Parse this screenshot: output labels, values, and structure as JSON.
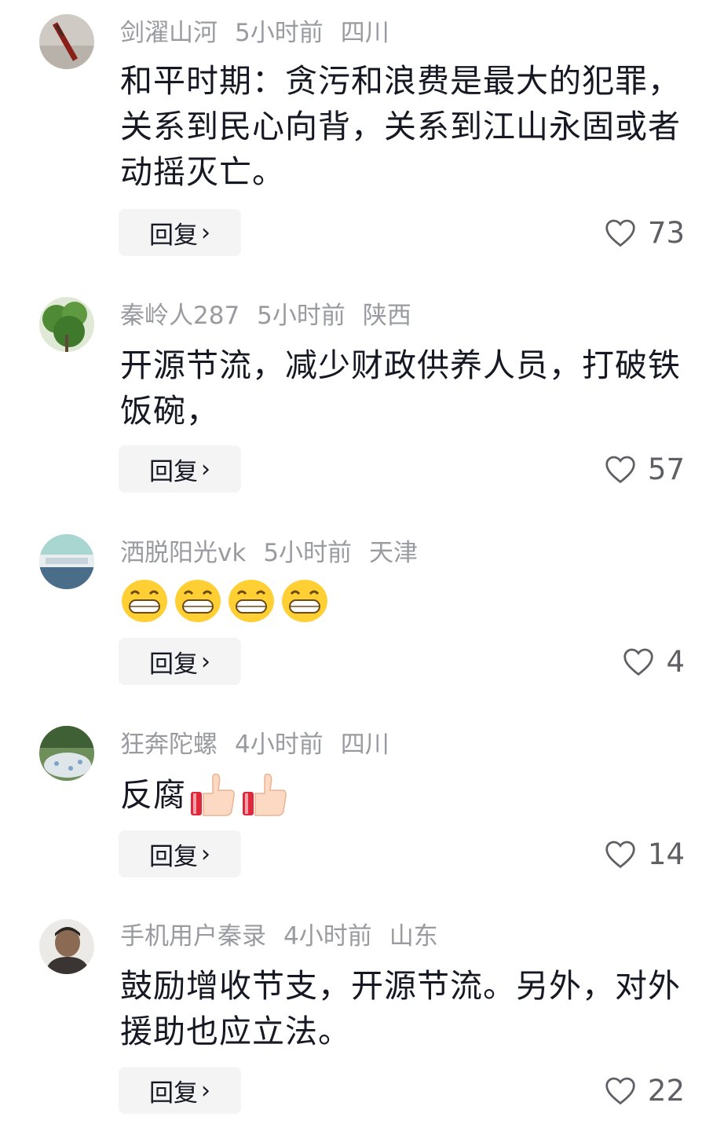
{
  "reply_label": "回复",
  "comments": [
    {
      "username": "剑濯山河",
      "time": "5小时前",
      "location": "四川",
      "text": "和平时期：贪污和浪费是最大的犯罪，关系到民心向背，关系到江山永固或者动摇灭亡。",
      "likes": "73"
    },
    {
      "username": "秦岭人287",
      "time": "5小时前",
      "location": "陕西",
      "text": "开源节流，减少财政供养人员，打破铁饭碗，",
      "likes": "57"
    },
    {
      "username": "洒脱阳光vk",
      "time": "5小时前",
      "location": "天津",
      "emojis": [
        "grin",
        "grin",
        "grin",
        "grin"
      ],
      "likes": "4"
    },
    {
      "username": "狂奔陀螺",
      "time": "4小时前",
      "location": "四川",
      "text": "反腐",
      "emojis": [
        "thumbs-up",
        "thumbs-up"
      ],
      "likes": "14"
    },
    {
      "username": "手机用户秦录",
      "time": "4小时前",
      "location": "山东",
      "text": "鼓励增收节支，开源节流。另外，对外援助也应立法。",
      "likes": "22"
    }
  ],
  "colors": {
    "meta": "#9a9ba1",
    "text": "#161823",
    "reply_bg": "#f4f4f5",
    "like": "#5f6066"
  }
}
